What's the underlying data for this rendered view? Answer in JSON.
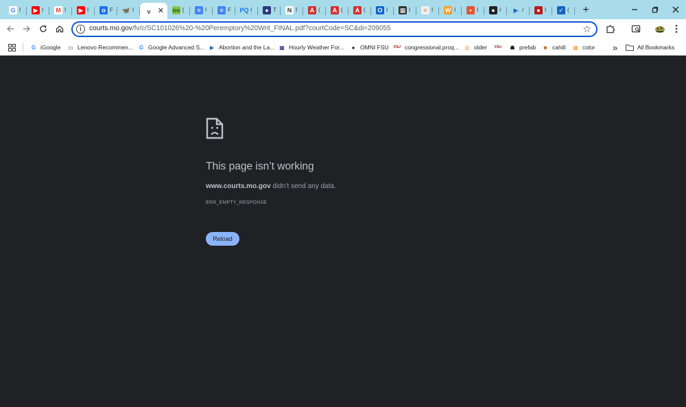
{
  "tabs": [
    {
      "icon": "google-icon",
      "color": "#ffffff",
      "glyph": "G",
      "glyph_color": "#4285f4",
      "label": "I"
    },
    {
      "icon": "youtube-icon",
      "color": "#ff0000",
      "glyph": "▶",
      "glyph_color": "#ffffff",
      "label": "I"
    },
    {
      "icon": "gmail-icon",
      "color": "#ffffff",
      "glyph": "M",
      "glyph_color": "#ea4335",
      "label": "I"
    },
    {
      "icon": "youtube-icon",
      "color": "#ff0000",
      "glyph": "▶",
      "glyph_color": "#ffffff",
      "label": "I"
    },
    {
      "icon": "app-icon",
      "color": "#1a73e8",
      "glyph": "o",
      "glyph_color": "#ffffff",
      "label": "F"
    },
    {
      "icon": "butterfly-icon",
      "color": "#a8dcea",
      "glyph": "🦋",
      "glyph_color": "#1185fe",
      "label": "I"
    },
    {
      "icon": "document-icon",
      "color": "#ffffff",
      "glyph": "v",
      "glyph_color": "#444444",
      "label": "",
      "active": true
    },
    {
      "icon": "green-app-icon",
      "color": "#8bc34a",
      "glyph": "oo",
      "glyph_color": "#1b5e20",
      "label": "["
    },
    {
      "icon": "docs-icon",
      "color": "#4285f4",
      "glyph": "≡",
      "glyph_color": "#ffffff",
      "label": "I"
    },
    {
      "icon": "docs-icon",
      "color": "#4285f4",
      "glyph": "≡",
      "glyph_color": "#ffffff",
      "label": "F"
    },
    {
      "icon": "pq-icon",
      "color": "#a8dcea",
      "glyph": "PQ",
      "glyph_color": "#1a73e8",
      "label": "I"
    },
    {
      "icon": "circle-app-icon",
      "color": "#2a3a7a",
      "glyph": "●",
      "glyph_color": "#ffffff",
      "label": "T"
    },
    {
      "icon": "news-icon",
      "color": "#ffffff",
      "glyph": "N",
      "glyph_color": "#333333",
      "label": "I"
    },
    {
      "icon": "pdf-icon",
      "color": "#d32f2f",
      "glyph": "A",
      "glyph_color": "#ffffff",
      "label": "("
    },
    {
      "icon": "pdf-icon",
      "color": "#d32f2f",
      "glyph": "A",
      "glyph_color": "#ffffff",
      "label": "("
    },
    {
      "icon": "pdf-icon",
      "color": "#d32f2f",
      "glyph": "A",
      "glyph_color": "#ffffff",
      "label": "("
    },
    {
      "icon": "outlook-icon",
      "color": "#0a64c8",
      "glyph": "O",
      "glyph_color": "#ffffff",
      "label": "I"
    },
    {
      "icon": "qr-icon",
      "color": "#333333",
      "glyph": "▦",
      "glyph_color": "#ffffff",
      "label": "I"
    },
    {
      "icon": "page-icon",
      "color": "#f0f0f0",
      "glyph": "≈",
      "glyph_color": "#c77",
      "label": "I"
    },
    {
      "icon": "w-icon",
      "color": "#f4a020",
      "glyph": "W",
      "glyph_color": "#ffffff",
      "label": "I"
    },
    {
      "icon": "red-square-icon",
      "color": "#e35336",
      "glyph": "▪",
      "glyph_color": "#ffffff",
      "label": "I"
    },
    {
      "icon": "dark-circle-icon",
      "color": "#222222",
      "glyph": "●",
      "glyph_color": "#ffffff",
      "label": "I"
    },
    {
      "icon": "play-icon",
      "color": "#a8dcea",
      "glyph": "▶",
      "glyph_color": "#1565c0",
      "label": "/"
    },
    {
      "icon": "red-circle-icon",
      "color": "#b71c1c",
      "glyph": "●",
      "glyph_color": "#ffffff",
      "label": "I"
    },
    {
      "icon": "shield-check-icon",
      "color": "#1565c0",
      "glyph": "✓",
      "glyph_color": "#ffffff",
      "label": "("
    }
  ],
  "toolbar": {
    "url_host": "courts.mo.gov",
    "url_path": "/fv/c/SC101026%20-%20Peremptory%20Writ_FINAL.pdf?courtCode=SC&di=209055"
  },
  "bookmarks": [
    {
      "icon": "google-icon",
      "glyph": "G",
      "glyph_color": "#4285f4",
      "label": "iGoogle"
    },
    {
      "icon": "folder-icon",
      "glyph": "▭",
      "glyph_color": "#444444",
      "label": "Lenovo Recommen..."
    },
    {
      "icon": "google-icon",
      "glyph": "G",
      "glyph_color": "#4285f4",
      "label": "Google Advanced S..."
    },
    {
      "icon": "play-icon",
      "glyph": "▶",
      "glyph_color": "#1565c0",
      "label": "Abortion and the La..."
    },
    {
      "icon": "weather-icon",
      "glyph": "▦",
      "glyph_color": "#1a237e",
      "label": "Hourly Weather For..."
    },
    {
      "icon": "globe-icon",
      "glyph": "●",
      "glyph_color": "#222222",
      "label": "OMNI FSU"
    },
    {
      "icon": "fsu-icon",
      "glyph": "FSU",
      "glyph_color": "#8b1a1a",
      "label": "congressional.proq..."
    },
    {
      "icon": "swirl-icon",
      "glyph": "◎",
      "glyph_color": "#e08030",
      "label": "older"
    },
    {
      "icon": "fsu-icon",
      "glyph": "FSU",
      "glyph_color": "#8b1a1a",
      "label": ""
    },
    {
      "icon": "robot-icon",
      "glyph": "☗",
      "glyph_color": "#222222",
      "label": "prefab"
    },
    {
      "icon": "face-icon",
      "glyph": "☻",
      "glyph_color": "#b06a20",
      "label": "cahill"
    },
    {
      "icon": "color-icon",
      "glyph": "▦",
      "glyph_color": "#f4a020",
      "label": "color"
    }
  ],
  "bookmarks_more": "»",
  "all_bookmarks_label": "All Bookmarks",
  "error": {
    "title": "This page isn’t working",
    "host": "www.courts.mo.gov",
    "message_suffix": " didn’t send any data.",
    "code": "ERR_EMPTY_RESPONSE",
    "reload_label": "Reload"
  },
  "colors": {
    "tabstrip_bg": "#a8dcea",
    "page_bg": "#202124",
    "focus_ring": "#0b57d0",
    "reload_button": "#8ab4f8"
  }
}
